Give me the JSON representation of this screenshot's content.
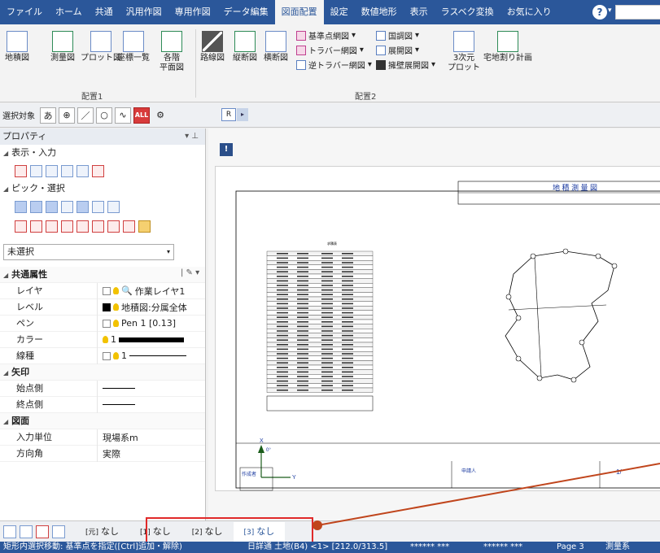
{
  "ribbon_tabs": [
    "ファイル",
    "ホーム",
    "共通",
    "汎用作図",
    "専用作図",
    "データ編集",
    "図面配置",
    "設定",
    "数値地形",
    "表示",
    "ラスベク変換",
    "お気に入り"
  ],
  "active_tab_index": 6,
  "help_label": "?",
  "ribbon": {
    "group1": {
      "label": "配置1",
      "buttons": [
        "地積図",
        "測量図",
        "プロット図",
        "座標一覧"
      ],
      "heimen_label": "各階",
      "heimen_sub": "平面図"
    },
    "group2": {
      "label": "配置2",
      "buttons": [
        "路線図",
        "縦断図",
        "横断図"
      ],
      "small_col1": [
        "基準点網図",
        "トラバー網図",
        "逆トラバー網図"
      ],
      "small_col2": [
        "国調図",
        "展開図",
        "擁壁展開図"
      ],
      "sanjigen": "3次元",
      "sanjigen_sub": "プロット",
      "takuchi": "宅地割り計画"
    }
  },
  "selection_toolbar": {
    "label": "選択対象",
    "buttons": [
      "あ",
      "⊕",
      "／",
      "○",
      "∿",
      "ALL",
      "⚙"
    ],
    "r_tab": "R"
  },
  "panel": {
    "title": "プロパティ",
    "sections": [
      "表示・入力",
      "ピック・選択"
    ],
    "combo_value": "未選択",
    "common_attr": {
      "title": "共通属性",
      "rows": [
        {
          "k": "レイヤ",
          "v": "作業レイヤ1"
        },
        {
          "k": "レベル",
          "v": "地積図:分属全体"
        },
        {
          "k": "ペン",
          "v": "Pen 1 [0.13]"
        },
        {
          "k": "カラー",
          "v": "1"
        },
        {
          "k": "線種",
          "v": "1"
        }
      ]
    },
    "arrow": {
      "title": "矢印",
      "rows": [
        {
          "k": "始点側"
        },
        {
          "k": "終点側"
        }
      ]
    },
    "drawing": {
      "title": "図面",
      "rows": [
        {
          "k": "入力単位",
          "v": "現場系m"
        },
        {
          "k": "方向角",
          "v": "実際"
        }
      ]
    }
  },
  "sheet": {
    "title": "地 積 測 量 図",
    "table_title": "求積表",
    "north_label": "X",
    "north_angle": "0°",
    "axis_y": "Y",
    "author_label": "作成者",
    "applicant_label": "申請人",
    "scale": "1/",
    "table_rows": 31
  },
  "layer_tabs": [
    {
      "num": "[元]",
      "label": "なし"
    },
    {
      "num": "[1]",
      "label": "なし"
    },
    {
      "num": "[2]",
      "label": "なし"
    },
    {
      "num": "[3]",
      "label": "なし"
    }
  ],
  "status": {
    "left": "矩形内選択移動: 基準点を指定([Ctrl]追加・解除)",
    "paper": "日詳通 土地(B4) <1> [212.0/313.5]",
    "x": "****** ***",
    "y": "****** ***",
    "page": "Page 3",
    "system": "測量系"
  },
  "colors": {
    "accent": "#2b579a",
    "highlight": "#e02a2a"
  }
}
